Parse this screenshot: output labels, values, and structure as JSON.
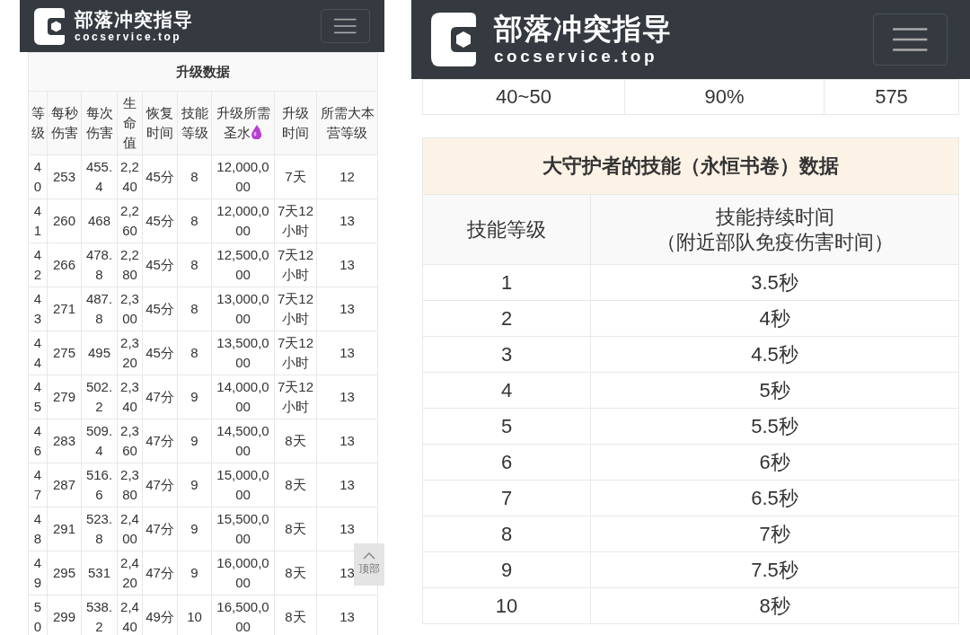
{
  "panels": [
    {
      "header": {
        "title": "部落冲突指导",
        "domain": "cocservice.top"
      },
      "upgrade_table": {
        "title": "升级数据",
        "columns": [
          {
            "label": "等级",
            "kind": "plain"
          },
          {
            "label": "每秒伤害",
            "kind": "plain"
          },
          {
            "label": "每次伤害",
            "kind": "plain"
          },
          {
            "label": "生命值",
            "kind": "plain"
          },
          {
            "label": "恢复时间",
            "kind": "plain"
          },
          {
            "label": "技能等级",
            "kind": "plain"
          },
          {
            "label": "升级所需圣水",
            "kind": "with_icon"
          },
          {
            "label": "升级时间",
            "kind": "plain"
          },
          {
            "label": "所需大本营等级",
            "kind": "plain"
          }
        ],
        "rows": [
          [
            "40",
            "253",
            "455.4",
            "2,240",
            "45分",
            "8",
            "12,000,000",
            "7天",
            "12"
          ],
          [
            "41",
            "260",
            "468",
            "2,260",
            "45分",
            "8",
            "12,000,000",
            "7天12小时",
            "13"
          ],
          [
            "42",
            "266",
            "478.8",
            "2,280",
            "45分",
            "8",
            "12,500,000",
            "7天12小时",
            "13"
          ],
          [
            "43",
            "271",
            "487.8",
            "2,300",
            "45分",
            "8",
            "13,000,000",
            "7天12小时",
            "13"
          ],
          [
            "44",
            "275",
            "495",
            "2,320",
            "45分",
            "8",
            "13,500,000",
            "7天12小时",
            "13"
          ],
          [
            "45",
            "279",
            "502.2",
            "2,340",
            "47分",
            "9",
            "14,000,000",
            "7天12小时",
            "13"
          ],
          [
            "46",
            "283",
            "509.4",
            "2,360",
            "47分",
            "9",
            "14,500,000",
            "8天",
            "13"
          ],
          [
            "47",
            "287",
            "516.6",
            "2,380",
            "47分",
            "9",
            "15,000,000",
            "8天",
            "13"
          ],
          [
            "48",
            "291",
            "523.8",
            "2,400",
            "47分",
            "9",
            "15,500,000",
            "8天",
            "13"
          ],
          [
            "49",
            "295",
            "531",
            "2,420",
            "47分",
            "9",
            "16,000,000",
            "8天",
            "13"
          ],
          [
            "50",
            "299",
            "538.2",
            "2,440",
            "49分",
            "10",
            "16,500,000",
            "8天",
            "13"
          ]
        ]
      },
      "back_to_top": {
        "label": "顶部"
      }
    },
    {
      "header": {
        "title": "部落冲突指导",
        "domain": "cocservice.top"
      },
      "partial_table": {
        "rows": [
          [
            "40~50",
            "90%",
            "575"
          ]
        ]
      },
      "skill_table": {
        "title": "大守护者的技能（永恒书卷）数据",
        "columns": [
          {
            "lines": [
              "技能等级"
            ]
          },
          {
            "lines": [
              "技能持续时间",
              "（附近部队免疫伤害时间）"
            ]
          }
        ],
        "rows": [
          [
            "1",
            "3.5秒"
          ],
          [
            "2",
            "4秒"
          ],
          [
            "3",
            "4.5秒"
          ],
          [
            "4",
            "5秒"
          ],
          [
            "5",
            "5.5秒"
          ],
          [
            "6",
            "6秒"
          ],
          [
            "7",
            "6.5秒"
          ],
          [
            "8",
            "7秒"
          ],
          [
            "9",
            "7.5秒"
          ],
          [
            "10",
            "8秒"
          ]
        ]
      }
    }
  ]
}
